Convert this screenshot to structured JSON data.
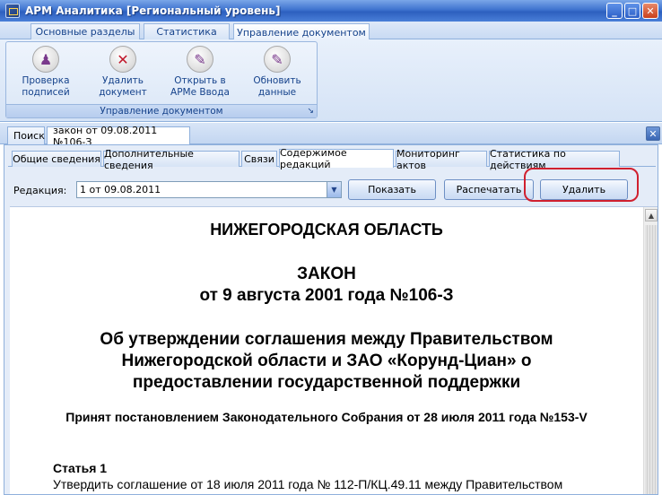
{
  "window": {
    "title": "АРМ Аналитика [Региональный уровень]",
    "minimize_glyph": "_",
    "maximize_glyph": "□",
    "close_glyph": "✕"
  },
  "ribbon_tabs": [
    {
      "label": "Основные разделы"
    },
    {
      "label": "Статистика"
    },
    {
      "label": "Управление документом"
    }
  ],
  "ribbon": {
    "group_caption": "Управление документом",
    "group_launcher_glyph": "↘",
    "buttons": [
      {
        "label": "Проверка\nподписей",
        "icon": "seal-icon",
        "glyph": "♟"
      },
      {
        "label": "Удалить\nдокумент",
        "icon": "delete-icon",
        "glyph": "✕"
      },
      {
        "label": "Открыть в\nАРМе Ввода",
        "icon": "pencil-icon",
        "glyph": "✎"
      },
      {
        "label": "Обновить\nданные",
        "icon": "pencil-icon",
        "glyph": "✎"
      }
    ]
  },
  "doc_tabs": [
    {
      "label": "Поиск"
    },
    {
      "label": "закон от 09.08.2011 №106-З"
    }
  ],
  "doc_close_glyph": "✕",
  "inner_tabs": [
    {
      "label": "Общие сведения"
    },
    {
      "label": "Дополнительные сведения"
    },
    {
      "label": "Связи"
    },
    {
      "label": "Содержимое редакций"
    },
    {
      "label": "Мониторинг актов"
    },
    {
      "label": "Статистика по действиям"
    }
  ],
  "toolbar": {
    "edition_label": "Редакция:",
    "edition_value": "1 от 09.08.2011",
    "dropdown_glyph": "▼",
    "show_label": "Показать",
    "print_label": "Распечатать",
    "delete_label": "Удалить"
  },
  "document": {
    "region": "НИЖЕГОРОДСКАЯ ОБЛАСТЬ",
    "law": "ЗАКОН",
    "date_number": "от 9 августа 2001 года №106-З",
    "title_line1": "Об утверждении соглашения между Правительством",
    "title_line2": "Нижегородской области и ЗАО «Корунд-Циан» о",
    "title_line3": "предоставлении государственной поддержки",
    "adopted": "Принят постановлением Законодательного Собрания от 28 июля 2011 года №153-V",
    "article_heading": "Статья 1",
    "article_text": "Утвердить соглашение от 18 июля 2011 года № 112-П/КЦ.49.11 между Правительством"
  },
  "scroll_up_glyph": "▲",
  "colors": {
    "titlebar": "#3f74cf",
    "ribbon_text": "#15428b",
    "highlight": "#d0202f"
  }
}
